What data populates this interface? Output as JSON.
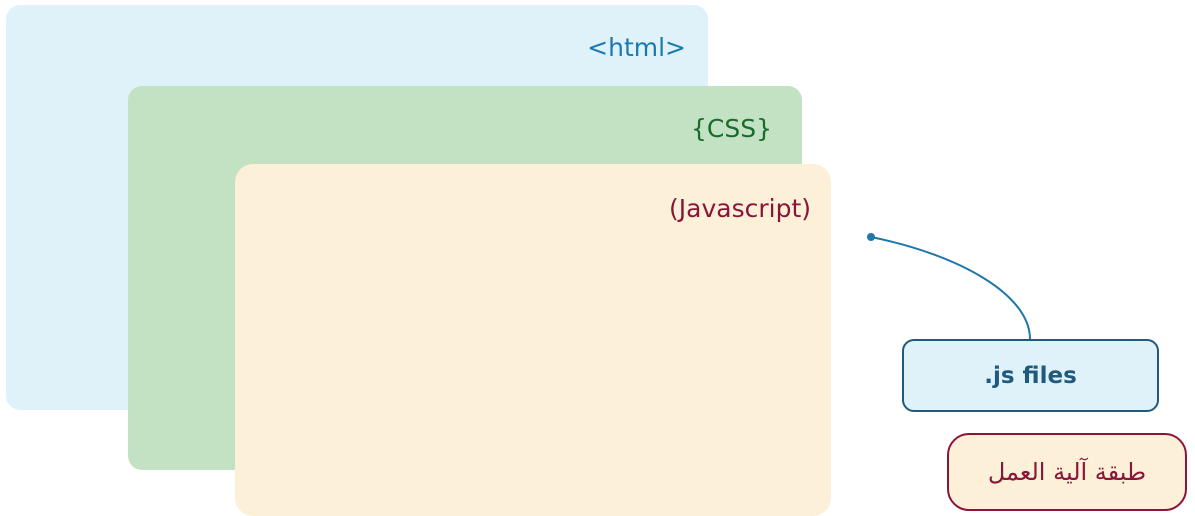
{
  "layers": {
    "html": {
      "label": "<html>"
    },
    "css": {
      "label": "{CSS}"
    },
    "javascript": {
      "label": "(Javascript)"
    }
  },
  "callouts": {
    "js_files": {
      "label": ".js files"
    },
    "behavior_layer": {
      "label": "طبقة آلية العمل"
    }
  },
  "colors": {
    "html_layer_bg": "#dff2fa",
    "html_label": "#1a7ab0",
    "css_layer_bg": "#c3e2c3",
    "css_label": "#1a6b2e",
    "js_layer_bg": "#fdf0d9",
    "js_label": "#8a1538",
    "connector": "#1f78a8",
    "js_files_text": "#1f5a7a",
    "behavior_text": "#8a1538"
  }
}
